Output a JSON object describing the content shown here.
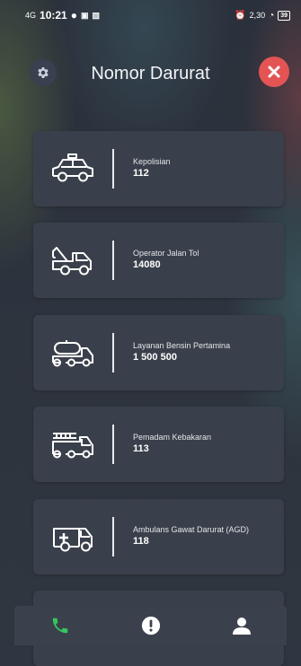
{
  "status_bar": {
    "signal": "4G",
    "time": "10:21",
    "right_info": "2,30",
    "battery": "39"
  },
  "header": {
    "title": "Nomor Darurat"
  },
  "contacts": [
    {
      "icon": "police-car-icon",
      "label": "Kepolisian",
      "number": "112"
    },
    {
      "icon": "tow-truck-icon",
      "label": "Operator Jalan Tol",
      "number": "14080"
    },
    {
      "icon": "fuel-tanker-icon",
      "label": "Layanan Bensin Pertamina",
      "number": "1 500 500"
    },
    {
      "icon": "fire-truck-icon",
      "label": "Pemadam Kebakaran",
      "number": "113"
    },
    {
      "icon": "ambulance-icon",
      "label": "Ambulans Gawat Darurat (AGD)",
      "number": "118"
    }
  ],
  "bottom_nav": {
    "items": [
      "phone-icon",
      "alert-icon",
      "profile-icon"
    ],
    "active_color": "#35c65b"
  },
  "colors": {
    "close_button": "#e45455",
    "card": "#3a404b",
    "background": "#2f3541"
  }
}
